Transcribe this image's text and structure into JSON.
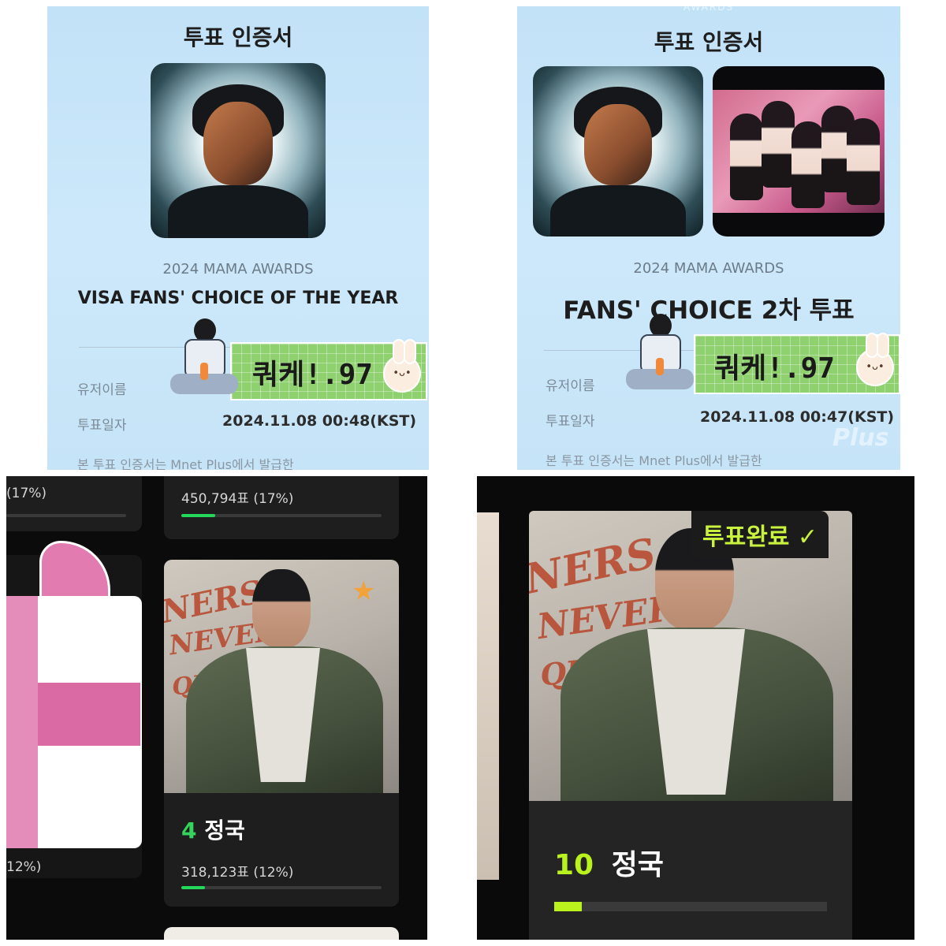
{
  "cert_left": {
    "title": "투표 인증서",
    "award_sub": "2024 MAMA AWARDS",
    "award_name": "VISA FANS' CHOICE OF THE YEAR",
    "user_label": "유저이름",
    "user_name": "쿼케!.97",
    "date_label": "투표일자",
    "date_value": "2024.11.08 00:48(KST)",
    "footnote": "본 투표 인증서는 Mnet Plus에서 발급한"
  },
  "cert_right": {
    "peek_text": "AWARDS",
    "title": "투표 인증서",
    "award_sub": "2024 MAMA AWARDS",
    "award_name": "FANS' CHOICE 2차 투표",
    "user_label": "유저이름",
    "user_name": "쿼케!.97",
    "date_label": "투표일자",
    "date_value": "2024.11.08 00:47(KST)",
    "footnote": "본 투표 인증서는 Mnet Plus에서 발급한",
    "watermark": "Plus"
  },
  "vote_left": {
    "top_left_percent": "(17%)",
    "top_card_votes": "450,794표 (17%)",
    "top_card_ratio": 0.17,
    "main_card": {
      "rank": "4",
      "name": "정국",
      "votes": "318,123표 (12%)",
      "ratio": 0.12
    },
    "bottom_left_percent": "12%)"
  },
  "vote_right": {
    "voted_badge": "투표완료 ✓",
    "rank": "10",
    "name": "정국",
    "ratio": 0.1
  },
  "colors": {
    "cert_bg": "#c2e2f8",
    "dark_bg": "#0b0b0b",
    "card_bg": "#1e1e1e",
    "green_bar": "#22d75a",
    "lime_accent": "#b9f21c",
    "tape_green": "#8fd06f"
  },
  "icons": {
    "check": "check-icon",
    "star": "star-icon",
    "bunny": "bunny-sticker-icon"
  }
}
